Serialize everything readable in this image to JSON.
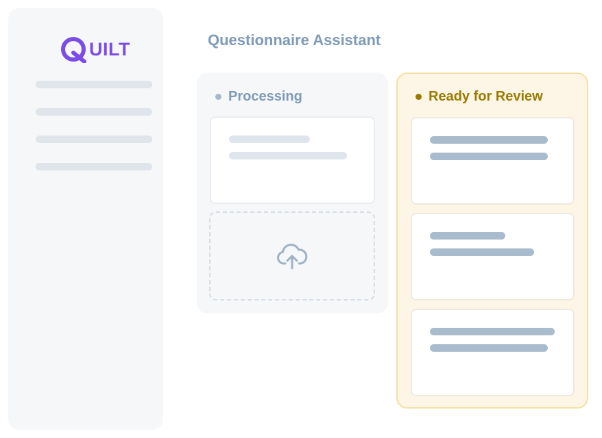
{
  "app": {
    "logo": {
      "text": "QUILT",
      "letter_mark": "Q",
      "letters_rest": "UILT",
      "brand_color": "#7c4ce6"
    },
    "page_title": "Questionnaire Assistant"
  },
  "columns": {
    "processing": {
      "label": "Processing",
      "status_color": "#a7b8c9",
      "cards": 1,
      "upload_icon": "cloud-upload-icon"
    },
    "review": {
      "label": "Ready for Review",
      "status_color": "#9a7a00",
      "accent_background": "#fdf6e6",
      "accent_border": "#f3e1a3",
      "cards": 3
    }
  }
}
